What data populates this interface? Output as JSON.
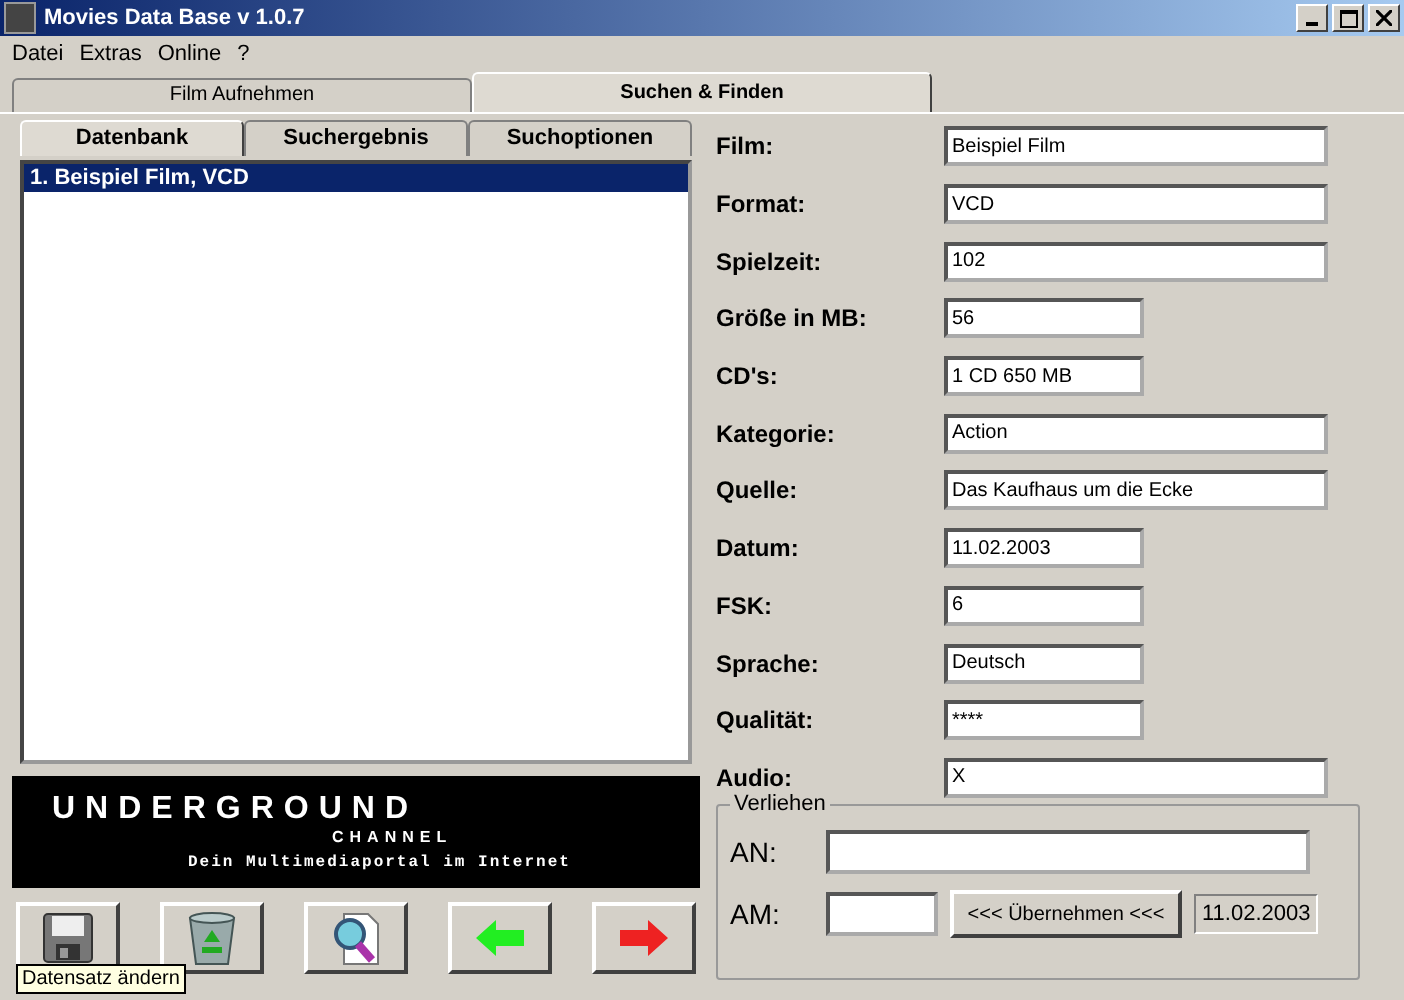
{
  "window": {
    "title": "Movies Data Base v 1.0.7"
  },
  "menu": [
    "Datei",
    "Extras",
    "Online",
    "?"
  ],
  "tabs": [
    {
      "label": "Film Aufnehmen",
      "selected": false
    },
    {
      "label": "Suchen & Finden",
      "selected": true
    }
  ],
  "subtabs": [
    {
      "label": "Datenbank",
      "selected": true
    },
    {
      "label": "Suchergebnis",
      "selected": false
    },
    {
      "label": "Suchoptionen",
      "selected": false
    }
  ],
  "list": [
    {
      "text": "1. Beispiel Film, VCD",
      "selected": true
    }
  ],
  "banner": {
    "title": "UNDERGROUND",
    "subtitle": "CHANNEL",
    "slogan": "Dein Multimediaportal im Internet"
  },
  "toolbar": [
    {
      "kind": "save"
    },
    {
      "kind": "recycle"
    },
    {
      "kind": "search"
    },
    {
      "kind": "back"
    },
    {
      "kind": "forward"
    }
  ],
  "tooltip": "Datensatz ändern",
  "fields": [
    {
      "label": "Film:",
      "value": "Beispiel Film",
      "kind": "wide"
    },
    {
      "label": "Format:",
      "value": "VCD",
      "kind": "wide"
    },
    {
      "label": "Spielzeit:",
      "value": "102",
      "kind": "wide"
    },
    {
      "label": "Größe in MB:",
      "value": "56",
      "kind": "short"
    },
    {
      "label": "CD's:",
      "value": "1 CD 650 MB",
      "kind": "short"
    },
    {
      "label": "Kategorie:",
      "value": "Action",
      "kind": "wide"
    },
    {
      "label": "Quelle:",
      "value": "Das Kaufhaus um die Ecke",
      "kind": "wide"
    },
    {
      "label": "Datum:",
      "value": "11.02.2003",
      "kind": "short"
    },
    {
      "label": "FSK:",
      "value": "6",
      "kind": "short"
    },
    {
      "label": "Sprache:",
      "value": "Deutsch",
      "kind": "short"
    },
    {
      "label": "Qualität:",
      "value": "****",
      "kind": "short"
    },
    {
      "label": "Audio:",
      "value": "X",
      "kind": "wide"
    }
  ],
  "lending": {
    "title": "Verliehen",
    "to_label": "AN:",
    "at_label": "AM:",
    "button": "<<< Übernehmen <<<",
    "date": "11.02.2003"
  }
}
